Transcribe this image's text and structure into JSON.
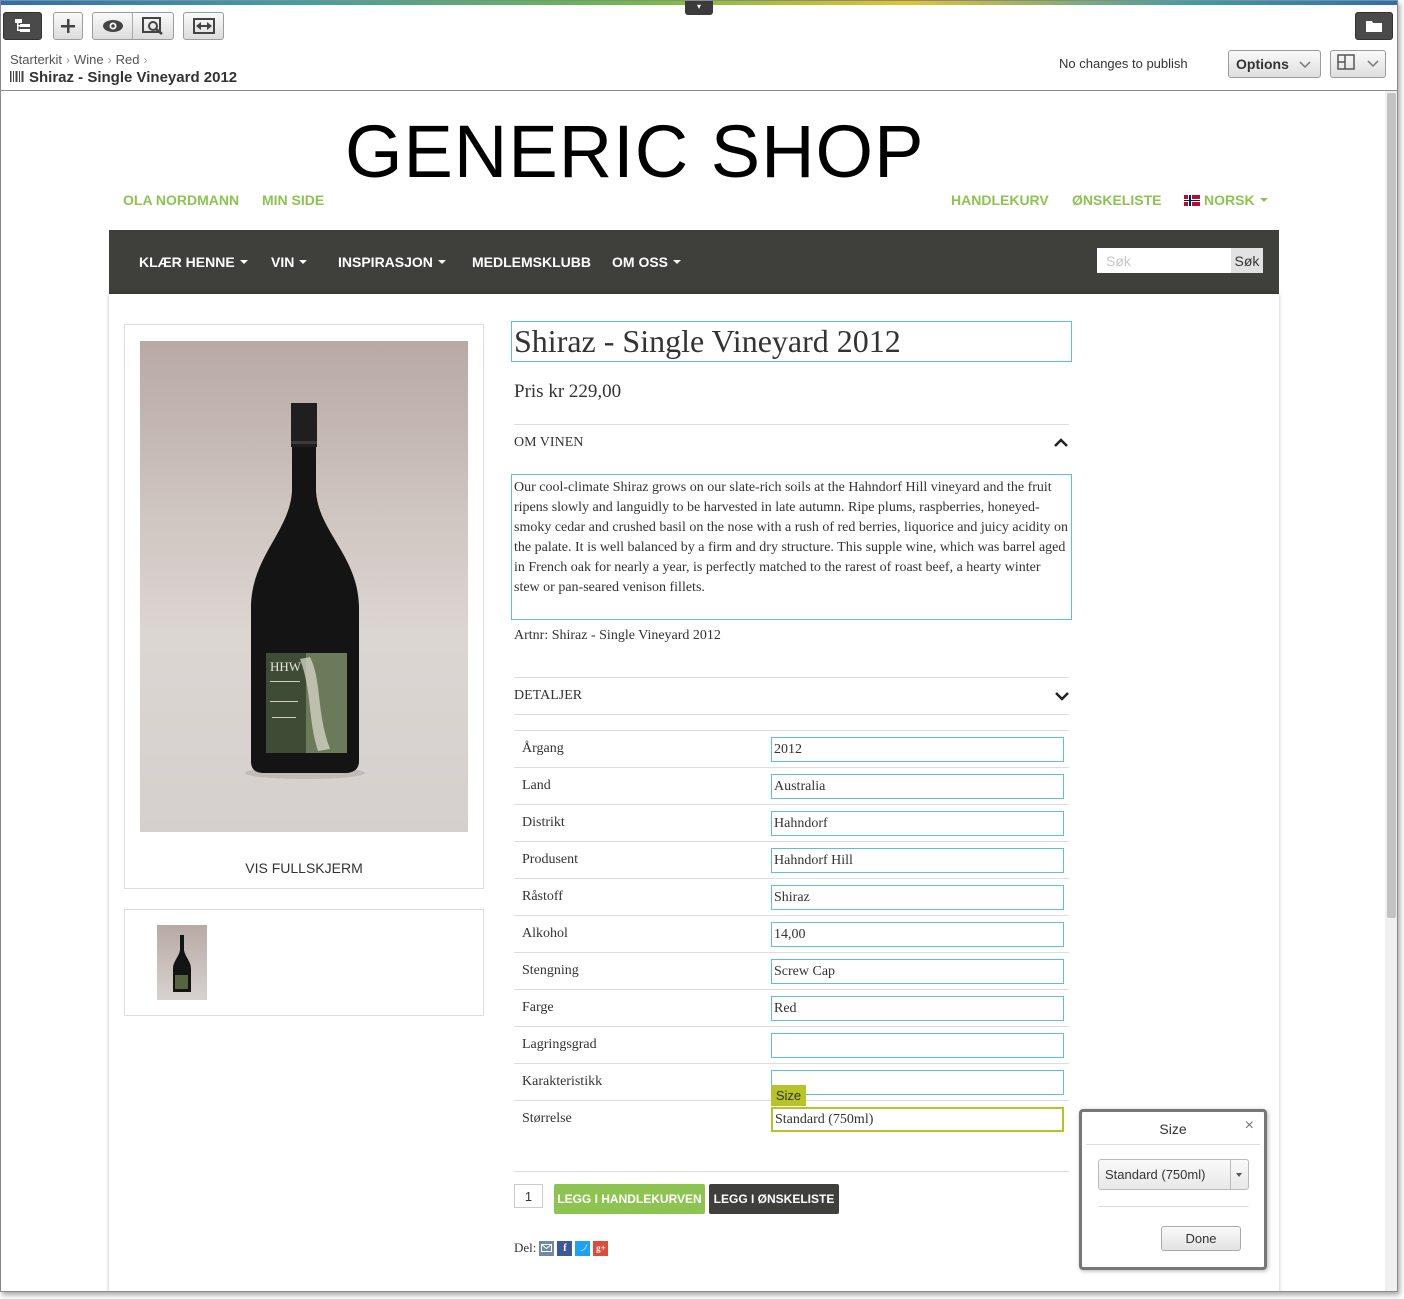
{
  "editor": {
    "breadcrumb": [
      "Starterkit",
      "Wine",
      "Red"
    ],
    "page_title": "Shiraz - Single Vineyard 2012",
    "publish_status": "No changes to publish",
    "options_label": "Options"
  },
  "site": {
    "logo": "GENERIC SHOP",
    "topnav_left": [
      "OLA NORDMANN",
      "MIN SIDE"
    ],
    "topnav_right": [
      "HANDLEKURV",
      "ØNSKELISTE",
      "NORSK"
    ],
    "mainnav": [
      "KLÆR HENNE",
      "VIN",
      "INSPIRASJON",
      "MEDLEMSKLUBB",
      "OM OSS"
    ],
    "search_placeholder": "Søk",
    "search_button": "Søk"
  },
  "product": {
    "title": "Shiraz - Single Vineyard 2012",
    "price": "Pris kr 229,00",
    "about_heading": "OM VINEN",
    "description": " Our cool-climate Shiraz grows on our slate-rich soils at the Hahndorf Hill vineyard and the fruit ripens slowly and languidly to be harvested in late autumn. Ripe plums, raspberries, honeyed-smoky cedar and crushed basil on the nose with a rush of red berries, liquorice and juicy acidity on the palate. It is well balanced by a firm and dry structure. This supple wine, which was barrel aged in French oak for nearly a year, is perfectly matched to the rarest of roast beef, a hearty winter stew or pan-seared venison fillets.",
    "artnr": "Artnr: Shiraz - Single Vineyard 2012",
    "details_heading": "DETALJER",
    "fullscreen_label": "VIS FULLSKJERM",
    "specs": [
      {
        "label": "Årgang",
        "value": "2012"
      },
      {
        "label": "Land",
        "value": "Australia"
      },
      {
        "label": "Distrikt",
        "value": "Hahndorf"
      },
      {
        "label": "Produsent",
        "value": "Hahndorf Hill"
      },
      {
        "label": "Råstoff",
        "value": "Shiraz"
      },
      {
        "label": "Alkohol",
        "value": "14,00"
      },
      {
        "label": "Stengning",
        "value": "Screw Cap"
      },
      {
        "label": "Farge",
        "value": "Red"
      },
      {
        "label": "Lagringsgrad",
        "value": ""
      },
      {
        "label": "Karakteristikk",
        "value": ""
      },
      {
        "label": "Størrelse",
        "value": "Standard (750ml)"
      }
    ],
    "size_tag": "Size",
    "quantity": "1",
    "add_to_cart": "LEGG I HANDLEKURVEN",
    "add_to_wishlist": "LEGG I ØNSKELISTE",
    "share_label": "Del:"
  },
  "size_popup": {
    "title": "Size",
    "close": "×",
    "selected": "Standard (750ml)",
    "done": "Done"
  },
  "colors": {
    "accent_green": "#8dc451",
    "nav_dark": "#3f3f3b",
    "edit_outline": "#5bc0de",
    "active_outline": "#b6c425"
  }
}
